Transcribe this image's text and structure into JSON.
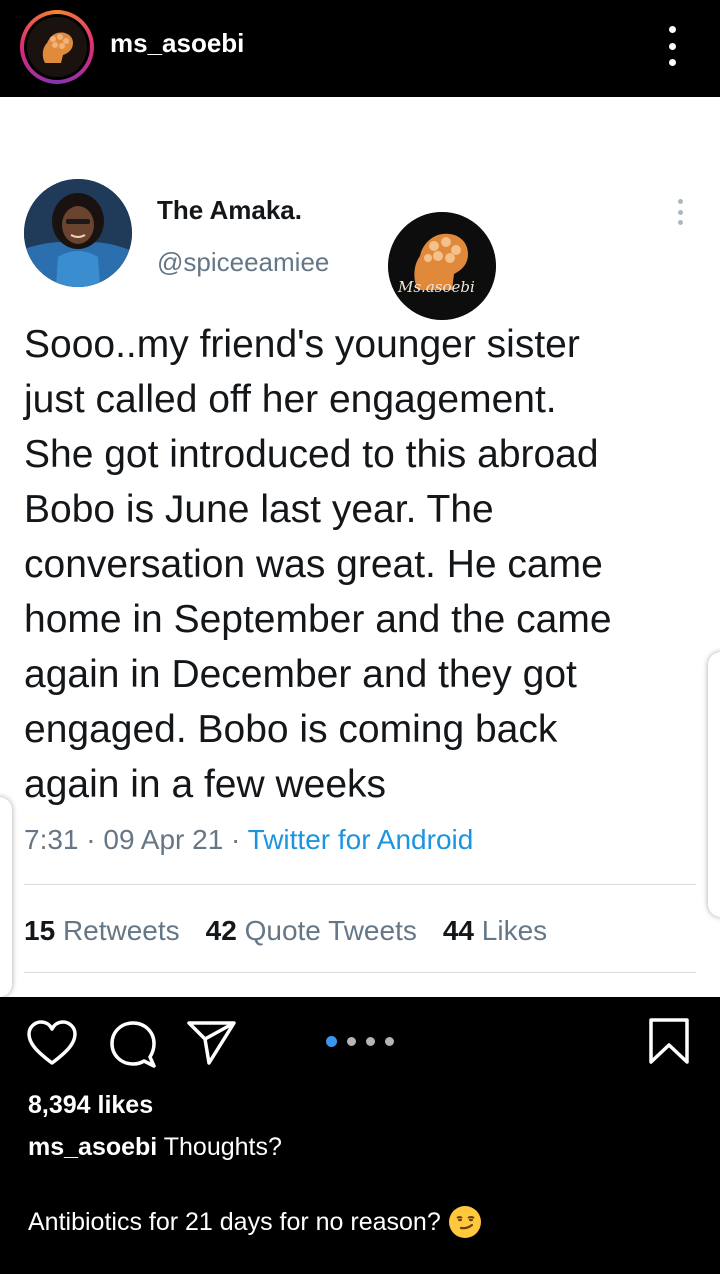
{
  "header": {
    "username": "ms_asoebi"
  },
  "tweet": {
    "display_name": "The Amaka.",
    "handle": "@spiceeamiee",
    "text": "Sooo..my friend's younger sister\njust called off her engagement.\nShe got introduced to this abroad\nBobo is June last year. The\nconversation was great. He came\nhome in September and the came\nagain in December and they got\nengaged. Bobo is coming back\nagain in a few weeks",
    "time": "7:31",
    "date": "09 Apr 21",
    "source": "Twitter for Android",
    "retweets_count": "15",
    "retweets_label": "Retweets",
    "quote_count": "42",
    "quote_label": "Quote Tweets",
    "likes_count": "44",
    "likes_label": "Likes",
    "watermark_text": "Ms.asoebi"
  },
  "carousel": {
    "total": 4,
    "active_index": 0
  },
  "post": {
    "likes": "8,394 likes",
    "caption_user": "ms_asoebi",
    "caption_text": "Thoughts?",
    "caption_line2": "Antibiotics for 21 days for no reason?",
    "caption_emoji": "smirking-face-emoji"
  },
  "colors": {
    "background": "#000000",
    "link_blue": "#1b95e0",
    "carousel_active": "#3897f0",
    "tweet_grey": "#657786"
  }
}
